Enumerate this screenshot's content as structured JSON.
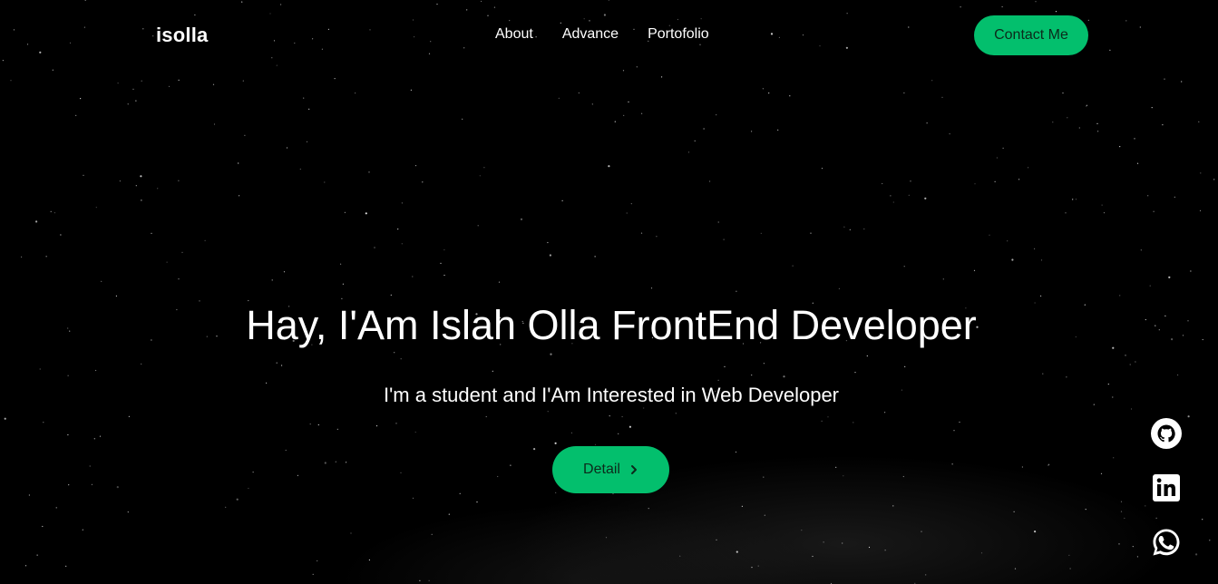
{
  "navbar": {
    "brand": "isolla",
    "links": [
      "About",
      "Advance",
      "Portofolio"
    ],
    "contact_label": "Contact Me"
  },
  "hero": {
    "title": "Hay, I'Am Islah Olla FrontEnd Developer",
    "subtitle": "I'm a student and I'Am Interested in Web Developer",
    "detail_label": "Detail",
    "detail_icon": "chevron-right-icon"
  },
  "socials": [
    {
      "icon": "github-icon"
    },
    {
      "icon": "linkedin-icon"
    },
    {
      "icon": "whatsapp-icon"
    }
  ],
  "colors": {
    "background": "#000000",
    "accent": "#03bf6d",
    "text": "#ffffff",
    "button_text": "#0c2a1b"
  }
}
